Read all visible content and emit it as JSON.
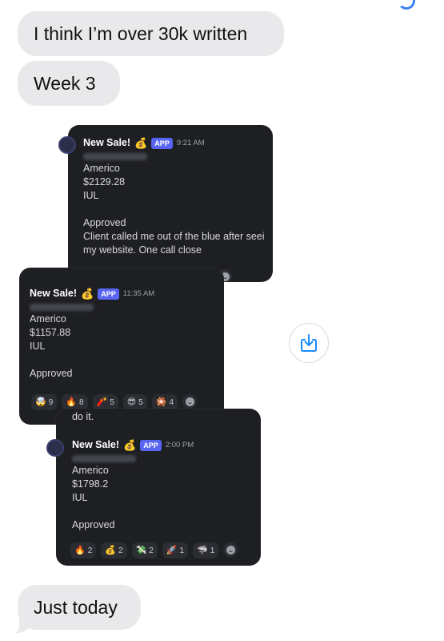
{
  "messages": {
    "m1": "I think I’m over 30k written",
    "m2": "Week 3",
    "m3": "Just today"
  },
  "cards": [
    {
      "title": "New Sale!",
      "app_badge": "APP",
      "time": "9:21 AM",
      "lines": [
        "Americo",
        "$2129.28",
        "IUL",
        "",
        "Approved",
        "Client called me out of the blue after seei",
        "my website. One call close"
      ]
    },
    {
      "title": "New Sale!",
      "app_badge": "APP",
      "time": "11:35 AM",
      "lines": [
        "Americo",
        "$1157.88",
        "IUL",
        "",
        "Approved"
      ],
      "reactions": [
        {
          "icon": "shocked-face-icon",
          "emoji": "🤯",
          "count": "9"
        },
        {
          "icon": "fire-icon",
          "emoji": "🔥",
          "count": "8"
        },
        {
          "icon": "firecracker-icon",
          "emoji": "🧨",
          "count": "5"
        },
        {
          "icon": "sunglasses-face-icon",
          "emoji": "😎",
          "count": "5"
        },
        {
          "icon": "sparkler-icon",
          "emoji": "🎇",
          "count": "4"
        }
      ]
    },
    {
      "title": "New Sale!",
      "app_badge": "APP",
      "time": "2:00 PM",
      "lines": [
        "Americo",
        "$1798.2",
        "IUL",
        "",
        "Approved"
      ],
      "reactions": [
        {
          "icon": "fire-icon",
          "emoji": "🔥",
          "count": "2"
        },
        {
          "icon": "money-bag-icon",
          "emoji": "💰",
          "count": "2"
        },
        {
          "icon": "money-wings-icon",
          "emoji": "💸",
          "count": "2"
        },
        {
          "icon": "rocket-icon",
          "emoji": "🚀",
          "count": "1"
        },
        {
          "icon": "shark-icon",
          "emoji": "🦈",
          "count": "1"
        }
      ]
    }
  ],
  "fragment_text": "do it.",
  "icons": {
    "money_bag": "💰",
    "download": "download-icon",
    "add_reaction": "add-reaction-icon"
  },
  "colors": {
    "bubble": "#e9e9eb",
    "card_bg": "#1e1f23",
    "app_badge": "#5865f2",
    "download_accent": "#1a8cff"
  }
}
